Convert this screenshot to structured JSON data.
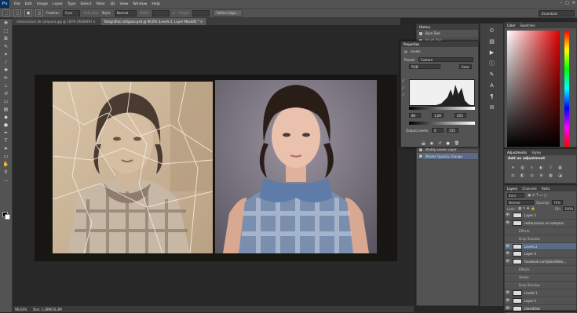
{
  "menubar": {
    "logo": "Ps",
    "items": [
      "File",
      "Edit",
      "Image",
      "Layer",
      "Type",
      "Select",
      "Filter",
      "3D",
      "View",
      "Window",
      "Help"
    ]
  },
  "options": {
    "feather_label": "Feather:",
    "feather_value": "0 px",
    "antialias_label": "Anti-alias",
    "style_label": "Style:",
    "style_value": "Normal",
    "width_label": "Width",
    "height_label": "Height",
    "refine_label": "Refine Edge...",
    "workspace": "Essentials"
  },
  "tabs": [
    {
      "label": "restauracion de compara.jpg @ 100% (RGB/8#)"
    },
    {
      "label": "fotografias antiguas.psd @ 96,6% (Levels 2, Layer Mask/8) *"
    }
  ],
  "status": {
    "zoom": "96,63%",
    "doc": "Doc: 1,28M/16,3M"
  },
  "history": {
    "title": "History",
    "items": [
      "Burn Tool",
      "Brush Tool",
      "Brush Tool",
      "Brush Tool",
      "Brush Tool",
      "Brush Tool",
      "Brush Tool",
      "Brush Tool",
      "Healing Brush",
      "Healing Brush",
      "Healing Brush",
      "Healing Brush",
      "Healing Brush",
      "Healing Brush",
      "Layer Order",
      "Levels 2 Layer",
      "Layer Order",
      "Modify Levels Layer",
      "Master Opacity Change"
    ]
  },
  "properties": {
    "title": "Properties",
    "panel_name": "Levels",
    "preset_label": "Preset:",
    "preset_value": "Custom",
    "channel": "RGB",
    "auto": "Auto",
    "in_black": "80",
    "in_gamma": "1,00",
    "in_white": "255",
    "output_label": "Output Levels:",
    "out_black": "0",
    "out_white": "255"
  },
  "color": {
    "title": "Color",
    "tab2": "Swatches"
  },
  "adjustments": {
    "title": "Adjustments",
    "tab2": "Styles",
    "subtitle": "Add an adjustment"
  },
  "layers": {
    "tabs": [
      "Layers",
      "Channels",
      "Paths"
    ],
    "kind": "Kind",
    "blend": "Normal",
    "opacity_label": "Opacity:",
    "opacity": "75%",
    "lock_label": "Lock:",
    "fill_label": "Fill:",
    "fill": "100%",
    "rows": [
      {
        "name": "Layer 3",
        "sub": false,
        "sel": false
      },
      {
        "name": "restauracion vs compara",
        "sub": false,
        "sel": false
      },
      {
        "name": "Effects",
        "sub": true,
        "sel": false
      },
      {
        "name": "Drop Shadow",
        "sub": true,
        "sel": false
      },
      {
        "name": "Levels 2",
        "sub": false,
        "sel": true
      },
      {
        "name": "Layer 4",
        "sub": false,
        "sel": false
      },
      {
        "name": "facebook.com/jdavidfoto...",
        "sub": false,
        "sel": false
      },
      {
        "name": "Effects",
        "sub": true,
        "sel": false
      },
      {
        "name": "Stroke",
        "sub": true,
        "sel": false
      },
      {
        "name": "Drop Shadow",
        "sub": true,
        "sel": false
      },
      {
        "name": "Levels 1",
        "sub": false,
        "sel": false
      },
      {
        "name": "Layer 2",
        "sub": false,
        "sel": false
      },
      {
        "name": "jdavidfoto",
        "sub": false,
        "sel": false
      }
    ]
  }
}
